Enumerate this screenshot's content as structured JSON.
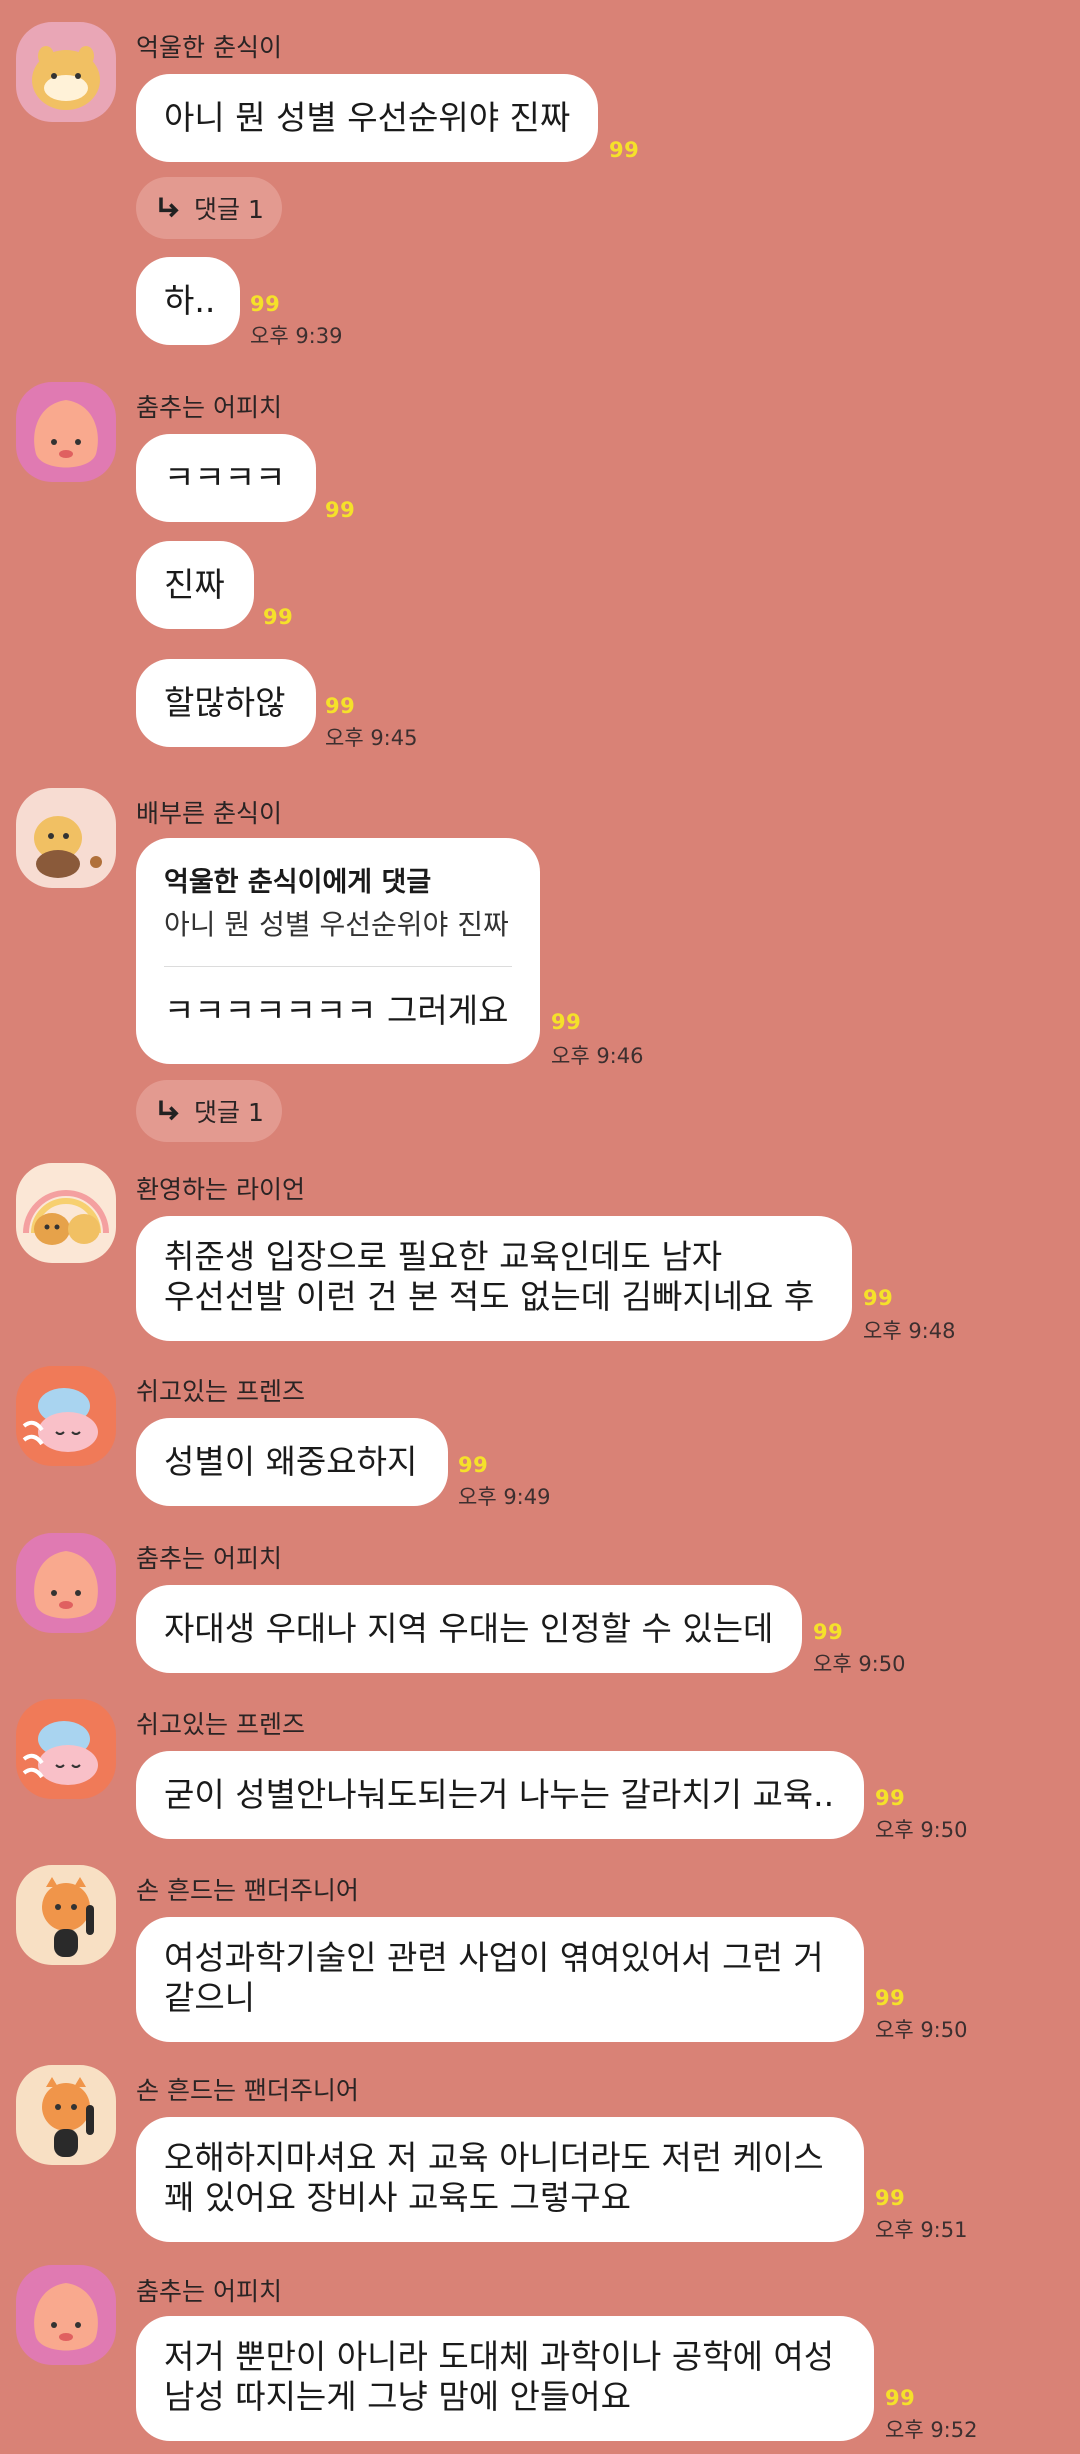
{
  "colors": {
    "background": "#d98276",
    "bubble": "#ffffff",
    "unread": "#f5e12a",
    "thread_button": "#e39a90"
  },
  "groups": [
    {
      "sender": "억울한 춘식이",
      "avatar": "choonsik-avatar",
      "messages": [
        {
          "text": "아니 뭔 성별 우선순위야 진짜",
          "unread": "99",
          "time": ""
        },
        {
          "text": "하..",
          "unread": "99",
          "time": "오후 9:39"
        }
      ],
      "thread": "댓글 1"
    },
    {
      "sender": "춤추는 어피치",
      "avatar": "apeach-avatar",
      "messages": [
        {
          "text": "ㅋㅋㅋㅋ",
          "unread": "99",
          "time": ""
        },
        {
          "text": "진짜",
          "unread": "99",
          "time": ""
        },
        {
          "text": "할많하않",
          "unread": "99",
          "time": "오후 9:45"
        }
      ]
    },
    {
      "sender": "배부른 춘식이",
      "avatar": "choonsik-eating-avatar",
      "reply": {
        "title": "억울한 춘식이에게 댓글",
        "quote": "아니 뭔 성별 우선순위야 진짜",
        "text": "ㅋㅋㅋㅋㅋㅋㅋ 그러게요",
        "unread": "99",
        "time": "오후 9:46"
      },
      "thread": "댓글 1"
    },
    {
      "sender": "환영하는 라이언",
      "avatar": "ryan-avatar",
      "messages": [
        {
          "lines": [
            "취준생 입장으로 필요한 교육인데도  남자",
            "우선선발 이런 건 본 적도 없는데 김빠지네요 후"
          ],
          "unread": "99",
          "time": "오후 9:48"
        }
      ]
    },
    {
      "sender": "쉬고있는 프렌즈",
      "avatar": "resting-friends-avatar",
      "messages": [
        {
          "text": "성별이 왜중요하지",
          "unread": "99",
          "time": "오후 9:49"
        }
      ]
    },
    {
      "sender": "춤추는 어피치",
      "avatar": "apeach-avatar",
      "messages": [
        {
          "text": "자대생 우대나 지역 우대는 인정할 수 있는데",
          "unread": "99",
          "time": "오후 9:50"
        }
      ]
    },
    {
      "sender": "쉬고있는 프렌즈",
      "avatar": "resting-friends-avatar",
      "messages": [
        {
          "text": "굳이 성별안나눠도되는거 나누는 갈라치기 교육..",
          "unread": "99",
          "time": "오후 9:50"
        }
      ]
    },
    {
      "sender": "손 흔드는 팬더주니어",
      "avatar": "panda-junior-avatar",
      "messages": [
        {
          "lines": [
            "여성과학기술인 관련 사업이 엮여있어서 그런 거",
            "같으니"
          ],
          "unread": "99",
          "time": "오후 9:50"
        }
      ]
    },
    {
      "sender": "손 흔드는 팬더주니어",
      "avatar": "panda-junior-avatar",
      "messages": [
        {
          "lines": [
            "오해하지마셔요 저 교육 아니더라도 저런 케이스",
            "꽤 있어요 장비사 교육도 그렇구요"
          ],
          "unread": "99",
          "time": "오후 9:51"
        }
      ]
    },
    {
      "sender": "춤추는 어피치",
      "avatar": "apeach-avatar",
      "messages": [
        {
          "lines": [
            "저거 뿐만이 아니라 도대체 과학이나 공학에 여성",
            "남성 따지는게 그냥 맘에 안들어요"
          ],
          "unread": "99",
          "time": "오후 9:52"
        }
      ]
    }
  ]
}
